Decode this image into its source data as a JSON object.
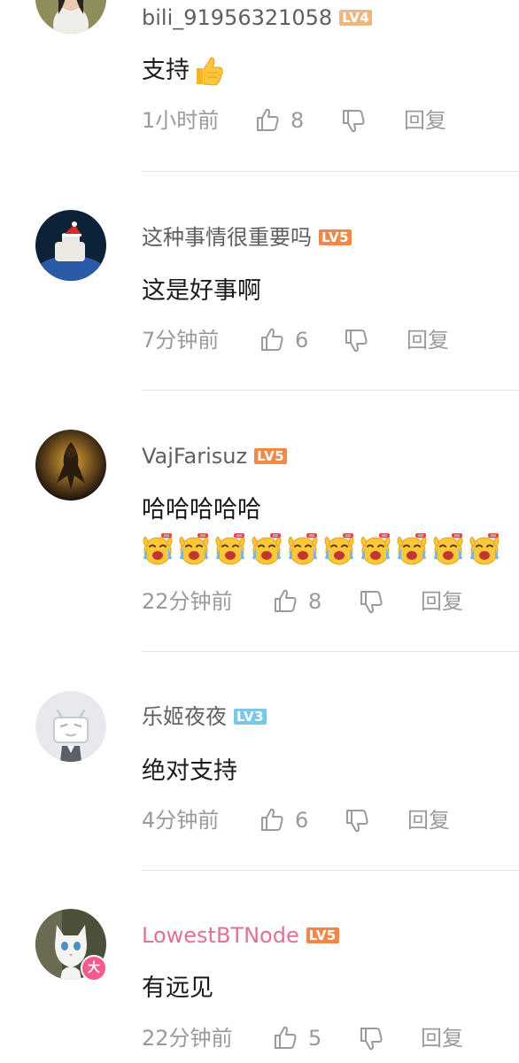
{
  "comments": [
    {
      "username": "bili_91956321058",
      "level": "LV4",
      "content": "支持",
      "content_emoji": "thumbs-up-emoji",
      "time": "1小时前",
      "likes": "8",
      "reply_label": "回复"
    },
    {
      "username": "这种事情很重要吗",
      "level": "LV5",
      "content": "这是好事啊",
      "time": "7分钟前",
      "likes": "6",
      "reply_label": "回复"
    },
    {
      "username": "VajFarisuz",
      "level": "LV5",
      "content": "哈哈哈哈哈",
      "content_emoji": "crying-laughing-emoji",
      "emoji_count": 10,
      "time": "22分钟前",
      "likes": "8",
      "reply_label": "回复"
    },
    {
      "username": "乐姬夜夜",
      "level": "LV3",
      "content": "绝对支持",
      "time": "4分钟前",
      "likes": "6",
      "reply_label": "回复"
    },
    {
      "username": "LowestBTNode",
      "level": "LV5",
      "content": "有远见",
      "time": "22分钟前",
      "likes": "5",
      "reply_label": "回复",
      "fan_badge": "大"
    }
  ],
  "icons": {
    "like": "thumbs-up-icon",
    "dislike": "thumbs-down-icon"
  },
  "colors": {
    "level_lv3": "#7bc7e6",
    "level_lv4": "#f3b67a",
    "level_lv5": "#f0884a",
    "vip_name": "#e26f9a",
    "fan_badge": "#f45a8d"
  }
}
